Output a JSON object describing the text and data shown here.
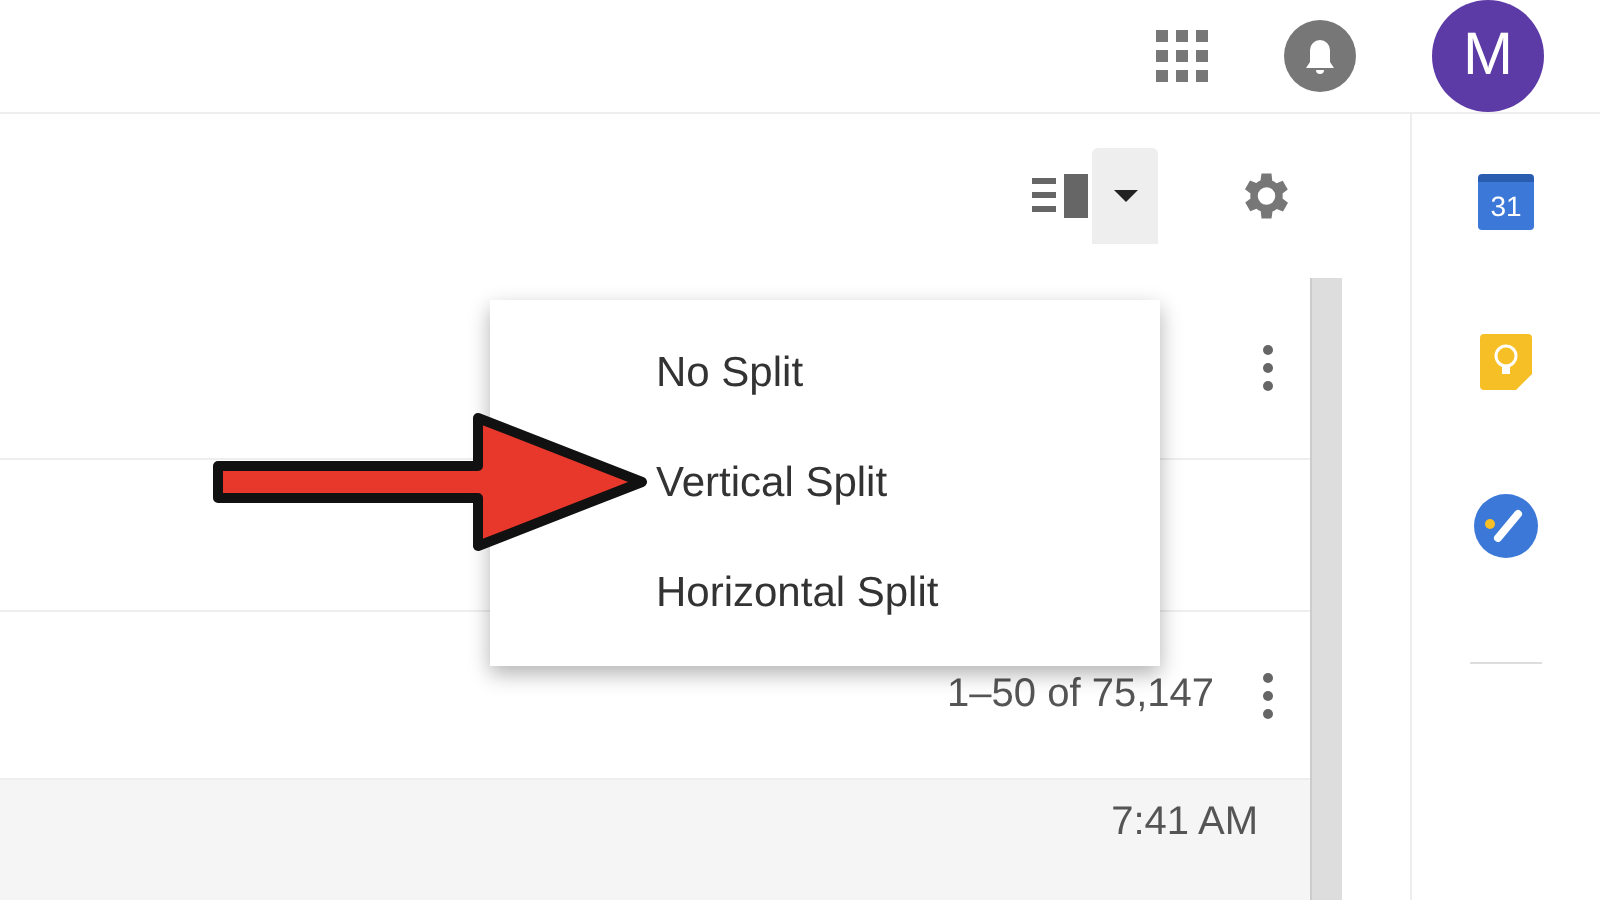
{
  "header": {
    "avatar_letter": "M"
  },
  "split_menu": {
    "open": true,
    "items": [
      {
        "label": "No Split"
      },
      {
        "label": "Vertical Split"
      },
      {
        "label": "Horizontal Split"
      }
    ]
  },
  "list": {
    "rows": [
      {
        "kind": "blank"
      },
      {
        "kind": "blank"
      },
      {
        "kind": "pager",
        "text": "1–50 of 75,147"
      },
      {
        "kind": "time",
        "text": "7:41 AM"
      }
    ]
  },
  "side_panel": {
    "calendar_day": "31"
  }
}
